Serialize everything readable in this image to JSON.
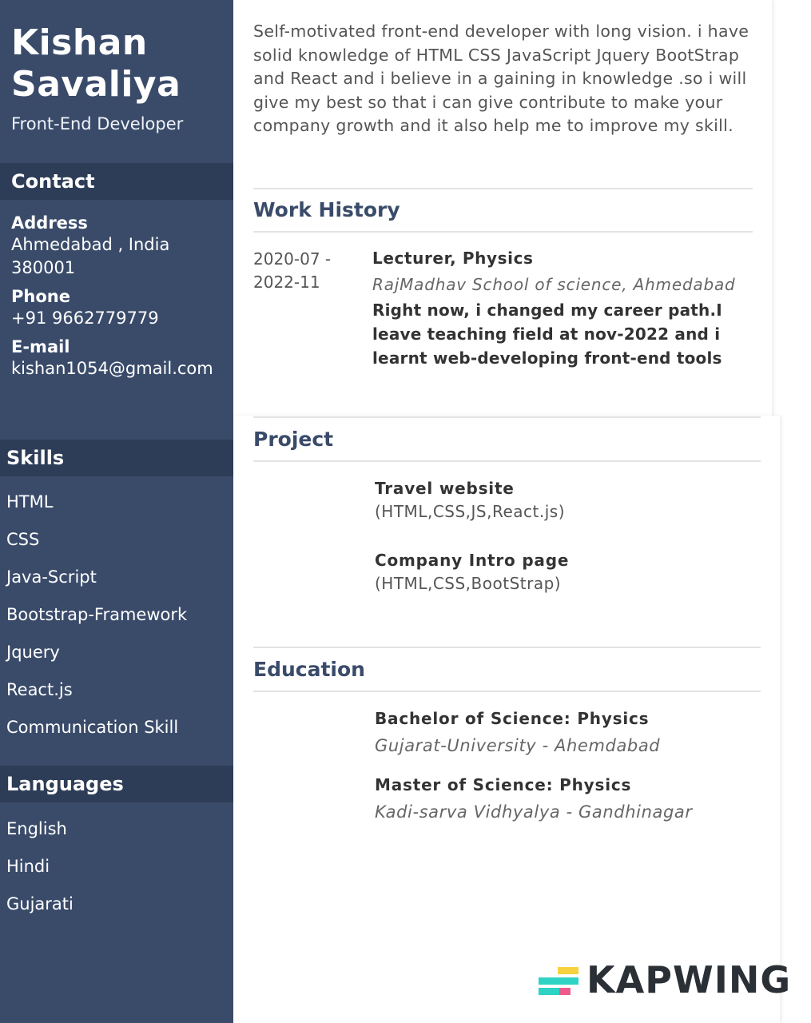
{
  "profile": {
    "name_line1": "Kishan",
    "name_line2": "Savaliya",
    "role": "Front-End Developer"
  },
  "contact": {
    "heading": "Contact",
    "address_label": "Address",
    "address_value": "Ahmedabad , India 380001",
    "phone_label": "Phone",
    "phone_value": "+91 9662779779",
    "email_label": "E-mail",
    "email_value": "kishan1054@gmail.com"
  },
  "skills": {
    "heading": "Skills",
    "items": [
      "HTML",
      "CSS",
      "Java-Script",
      "Bootstrap-Framework",
      "Jquery",
      "React.js",
      "Communication Skill"
    ]
  },
  "languages": {
    "heading": "Languages",
    "items": [
      "English",
      "Hindi",
      "Gujarati"
    ]
  },
  "summary": "Self-motivated front-end developer with long vision. i have solid knowledge of HTML CSS JavaScript Jquery BootStrap and React and i believe in a gaining in knowledge .so i will give my best so that i can give contribute to make your company growth and it also help me to improve my skill.",
  "work_history": {
    "heading": "Work History",
    "period_start": "2020-07 -",
    "period_end": "2022-11",
    "title": "Lecturer, Physics",
    "organization": "RajMadhav School of science, Ahmedabad",
    "description": "Right now, i changed my career path.I leave teaching field at nov-2022 and i learnt web-developing front-end tools"
  },
  "projects": {
    "heading": "Project",
    "items": [
      {
        "title": "Travel website",
        "tech": "(HTML,CSS,JS,React.js)"
      },
      {
        "title": "Company Intro page",
        "tech": "(HTML,CSS,BootStrap)"
      }
    ]
  },
  "education": {
    "heading": "Education",
    "items": [
      {
        "degree": "Bachelor of Science: Physics",
        "institution": "Gujarat-University - Ahemdabad"
      },
      {
        "degree": "Master of Science: Physics",
        "institution": "Kadi-sarva Vidhyalya - Gandhinagar"
      }
    ]
  },
  "watermark": {
    "text": "KAPWING",
    "colors": {
      "teal": "#2fd3c4",
      "yellow": "#f7d23e",
      "pink": "#ef5a8c"
    }
  },
  "colors": {
    "sidebar": "#3a4b6a",
    "section_bar": "#2e3d57",
    "heading_text": "#3a4b6a"
  }
}
